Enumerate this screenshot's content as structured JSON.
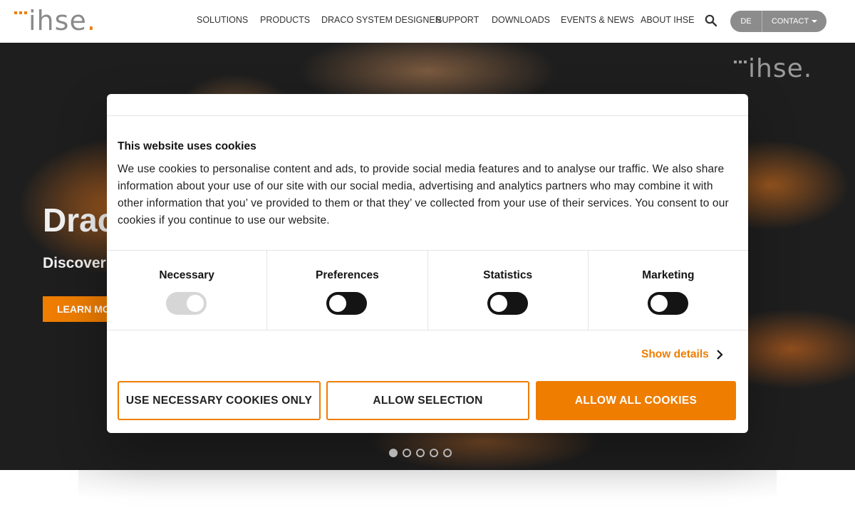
{
  "header": {
    "logo_text": "ihse",
    "logo_period": ".",
    "nav": [
      {
        "label": "SOLUTIONS"
      },
      {
        "label": "PRODUCTS"
      },
      {
        "label": "DRACO SYSTEM DESIGNER"
      },
      {
        "label": "SUPPORT"
      },
      {
        "label": "DOWNLOADS"
      },
      {
        "label": "EVENTS & NEWS"
      },
      {
        "label": "ABOUT IHSE"
      }
    ],
    "search_icon": "search-icon",
    "lang_label": "DE",
    "contact_label": "CONTACT"
  },
  "hero": {
    "logo_text": "ihse.",
    "title": "Draco",
    "subtitle": "Discover",
    "cta_label": "LEARN MORE",
    "carousel": {
      "count": 5,
      "active_index": 0
    }
  },
  "cookie_dialog": {
    "title": "This website uses cookies",
    "text": "We use cookies to personalise content and ads, to provide social media features and to analyse our traffic. We also share information about your use of our site with our social media, advertising and analytics partners who may combine it with other information that you’ ve provided to them or that they’ ve collected from your use of their services. You consent to our cookies if you continue to use our website.",
    "categories": [
      {
        "label": "Necessary",
        "enabled": true,
        "disabled": true
      },
      {
        "label": "Preferences",
        "enabled": false,
        "disabled": false
      },
      {
        "label": "Statistics",
        "enabled": false,
        "disabled": false
      },
      {
        "label": "Marketing",
        "enabled": false,
        "disabled": false
      }
    ],
    "show_details_label": "Show details",
    "buttons": {
      "necessary_only": "USE NECESSARY COOKIES ONLY",
      "allow_selection": "ALLOW SELECTION",
      "allow_all": "ALLOW ALL COOKIES"
    }
  },
  "colors": {
    "accent": "#ee7d00",
    "toggle_on_track": "#141414",
    "toggle_disabled": "#d6d6d6",
    "hero_background": "#1e1e1e",
    "pill_gray": "#8c8c8c"
  }
}
